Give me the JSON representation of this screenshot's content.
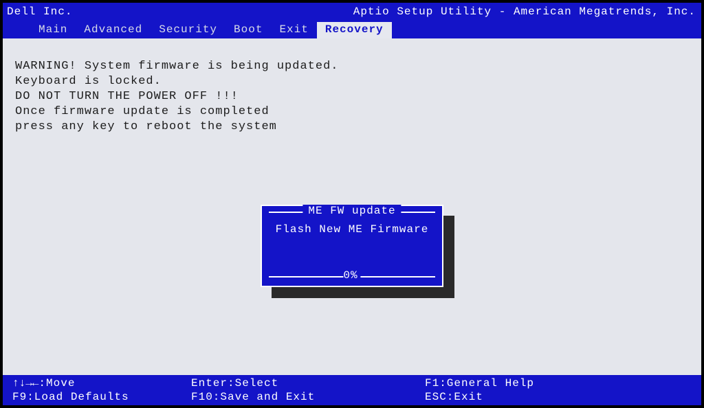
{
  "vendor": "Dell Inc.",
  "utility_title": "Aptio Setup Utility - American Megatrends, Inc.",
  "tabs": {
    "items": [
      {
        "label": "Main"
      },
      {
        "label": "Advanced"
      },
      {
        "label": "Security"
      },
      {
        "label": "Boot"
      },
      {
        "label": "Exit"
      },
      {
        "label": "Recovery"
      }
    ],
    "active_index": 5
  },
  "warning": {
    "line1": "WARNING! System firmware is being updated.",
    "line2": "Keyboard is locked.",
    "line3": "DO NOT TURN THE POWER OFF !!!",
    "line4": "Once firmware update is completed",
    "line5": "press any key to reboot the system"
  },
  "dialog": {
    "title": "ME FW update",
    "message": "Flash New ME Firmware",
    "progress_text": "0%",
    "progress_value": 0
  },
  "footer": {
    "arrows_glyph": "↑↓→←",
    "move": ":Move",
    "f9": "F9:Load Defaults",
    "enter": "Enter:Select",
    "f10": "F10:Save and Exit",
    "f1": "F1:General Help",
    "esc": "ESC:Exit"
  }
}
